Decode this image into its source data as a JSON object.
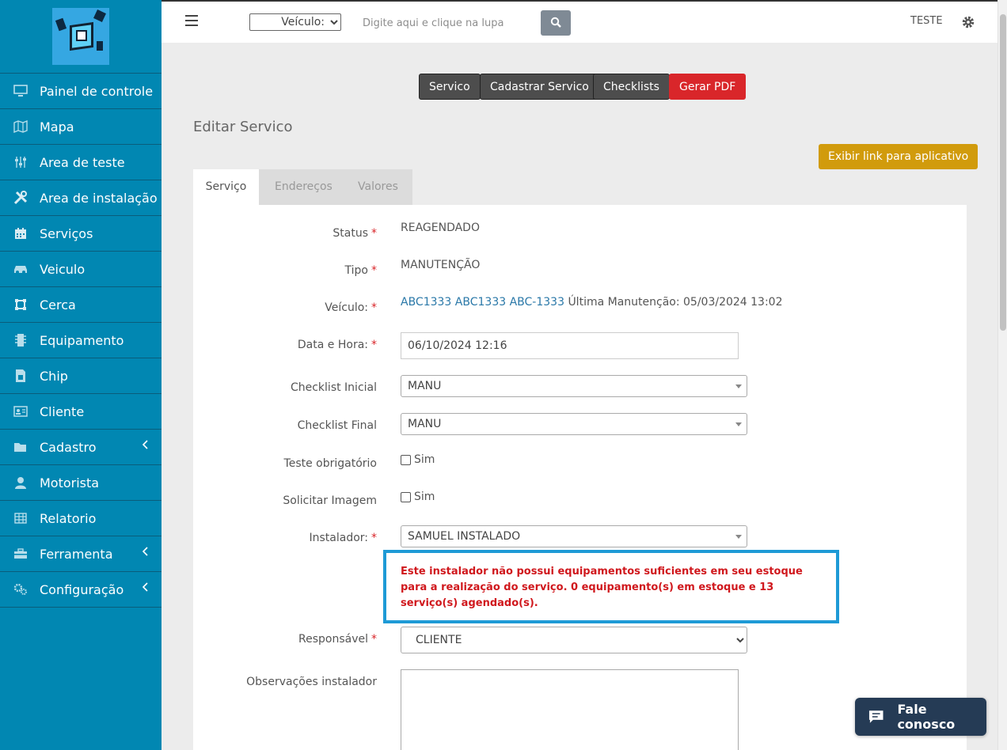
{
  "sidebar": {
    "items": [
      {
        "label": "Painel de controle",
        "icon": "monitor-icon"
      },
      {
        "label": "Mapa",
        "icon": "map-icon"
      },
      {
        "label": "Area de teste",
        "icon": "sliders-icon"
      },
      {
        "label": "Area de instalação",
        "icon": "tools-icon"
      },
      {
        "label": "Serviços",
        "icon": "calendar-icon"
      },
      {
        "label": "Veiculo",
        "icon": "car-icon"
      },
      {
        "label": "Cerca",
        "icon": "fence-icon"
      },
      {
        "label": "Equipamento",
        "icon": "chip-icon"
      },
      {
        "label": "Chip",
        "icon": "sim-icon"
      },
      {
        "label": "Cliente",
        "icon": "id-card-icon"
      },
      {
        "label": "Cadastro",
        "icon": "folder-icon"
      },
      {
        "label": "Motorista",
        "icon": "user-icon"
      },
      {
        "label": "Relatorio",
        "icon": "table-icon"
      },
      {
        "label": "Ferramenta",
        "icon": "toolbox-icon"
      },
      {
        "label": "Configuração",
        "icon": "gears-icon"
      }
    ]
  },
  "topbar": {
    "vehicle_select": "Veículo:",
    "search_placeholder": "Digite aqui e clique na lupa",
    "user": "TESTE"
  },
  "toolbar": {
    "servico": "Servico",
    "cadastrar": "Cadastrar Servico",
    "checklists": "Checklists",
    "pdf": "Gerar PDF"
  },
  "page_title": "Editar Servico",
  "link_button": "Exibir link para aplicativo",
  "tabs": {
    "servico": "Serviço",
    "enderecos": "Endereços",
    "valores": "Valores"
  },
  "form": {
    "status_label": "Status",
    "status_value": "REAGENDADO",
    "tipo_label": "Tipo",
    "tipo_value": "MANUTENÇÃO",
    "veiculo_label": "Veículo:",
    "veiculo_link": "ABC1333 ABC1333 ABC-1333",
    "veiculo_extra": "Última Manutenção: 05/03/2024 13:02",
    "data_label": "Data e Hora:",
    "data_value": "06/10/2024 12:16",
    "checklist_inicial_label": "Checklist Inicial",
    "checklist_inicial_value": "MANU",
    "checklist_final_label": "Checklist Final",
    "checklist_final_value": "MANU",
    "teste_label": "Teste obrigatório",
    "teste_check": "Sim",
    "imagem_label": "Solicitar Imagem",
    "imagem_check": "Sim",
    "instalador_label": "Instalador:",
    "instalador_value": "SAMUEL INSTALADO",
    "warning": "Este instalador não possui equipamentos suficientes em seu estoque para a realização do serviço. 0 equipamento(s) em estoque e 13 serviço(s) agendado(s).",
    "responsavel_label": "Responsável",
    "responsavel_value": "CLIENTE",
    "obs_label": "Observações instalador"
  },
  "chat": {
    "label": "Fale conosco"
  },
  "colors": {
    "sidebar": "#0187b2",
    "danger": "#d9262a",
    "warning_border": "#1e9ad6",
    "link_button": "#d19b0c",
    "chat": "#253b55"
  }
}
